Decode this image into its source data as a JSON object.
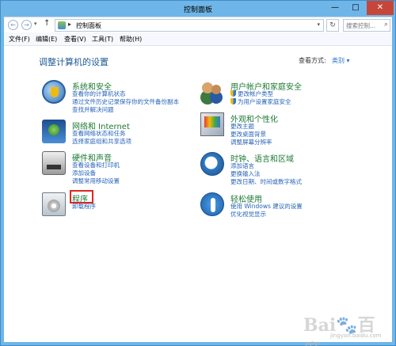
{
  "window": {
    "title": "控制面板",
    "min_glyph": "—",
    "max_glyph": "□",
    "close_glyph": "✕"
  },
  "navbar": {
    "back_glyph": "←",
    "forward_glyph": "→",
    "dropdown_glyph": "▾",
    "up_glyph": "↑",
    "breadcrumb_sep": "▸",
    "address": "控制面板",
    "refresh_glyph": "↻",
    "search_placeholder": "搜索控制...",
    "search_glyph": "⌕"
  },
  "menubar": {
    "items": [
      {
        "label": "文件(F)"
      },
      {
        "label": "编辑(E)"
      },
      {
        "label": "查看(V)"
      },
      {
        "label": "工具(T)"
      },
      {
        "label": "帮助(H)"
      }
    ]
  },
  "main": {
    "title": "调整计算机的设置",
    "view_by_label": "查看方式:",
    "view_by_value": "类别 ▾"
  },
  "categories": {
    "security": {
      "title": "系统和安全",
      "links": [
        "查看你的计算机状态",
        "通过文件历史记录保存你的文件备份副本",
        "查找并解决问题"
      ]
    },
    "network": {
      "title": "网络和 Internet",
      "links": [
        "查看网络状态和任务",
        "选择家庭组和共享选项"
      ]
    },
    "hardware": {
      "title": "硬件和声音",
      "links": [
        "查看设备和打印机",
        "添加设备",
        "调整常用移动设置"
      ]
    },
    "programs": {
      "title": "程序",
      "links": [
        "卸载程序"
      ]
    },
    "users": {
      "title": "用户帐户和家庭安全",
      "links": [
        "更改帐户类型",
        "为用户设置家庭安全"
      ]
    },
    "appearance": {
      "title": "外观和个性化",
      "links": [
        "更改主题",
        "更改桌面背景",
        "调整屏幕分辨率"
      ]
    },
    "clock": {
      "title": "时钟、语言和区域",
      "links": [
        "添加语言",
        "更换输入法",
        "更改日期、时间或数字格式"
      ]
    },
    "ease": {
      "title": "轻松使用",
      "links": [
        "使用 Windows 建议的设置",
        "优化视觉显示"
      ]
    }
  },
  "watermark": {
    "text": "Bai🐾百度",
    "sub": "jingyan.baidu.com"
  }
}
